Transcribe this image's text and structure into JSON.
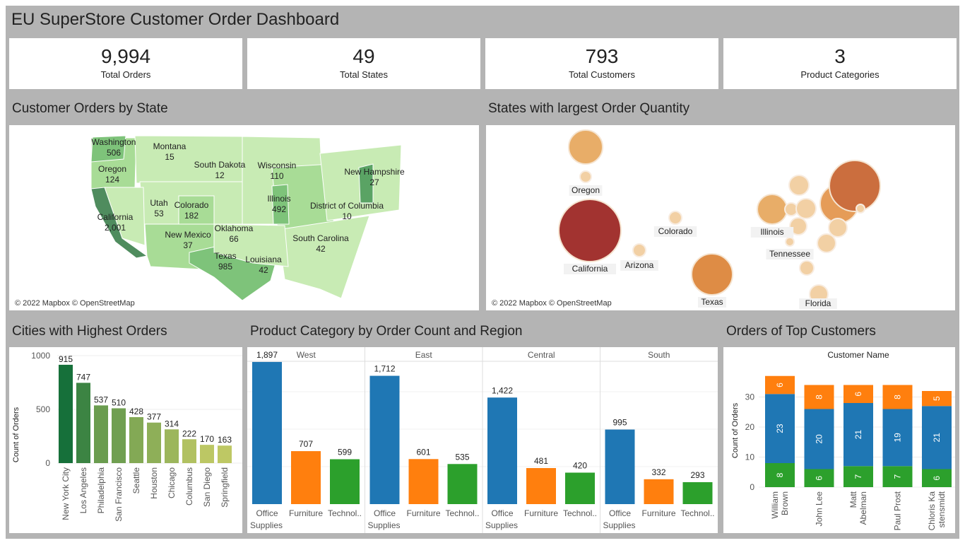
{
  "header": {
    "title": "EU SuperStore Customer Order Dashboard"
  },
  "kpis": [
    {
      "value": "9,994",
      "label": "Total Orders"
    },
    {
      "value": "49",
      "label": "Total States"
    },
    {
      "value": "793",
      "label": "Total Customers"
    },
    {
      "value": "3",
      "label": "Product Categories"
    }
  ],
  "sections": {
    "map": "Customer Orders by State",
    "bubbles": "States with largest Order Quantity",
    "cities": "Cities with Highest Orders",
    "category": "Product Category by Order Count and Region",
    "customers": "Orders of Top Customers"
  },
  "attribution": "© 2022 Mapbox © OpenStreetMap",
  "state_labels": [
    {
      "name": "Washington",
      "value": "506"
    },
    {
      "name": "Montana",
      "value": "15"
    },
    {
      "name": "Oregon",
      "value": "124"
    },
    {
      "name": "South Dakota",
      "value": "12"
    },
    {
      "name": "Wisconsin",
      "value": "110"
    },
    {
      "name": "New Hampshire",
      "value": "27"
    },
    {
      "name": "Illinois",
      "value": "492"
    },
    {
      "name": "Utah",
      "value": "53"
    },
    {
      "name": "Colorado",
      "value": "182"
    },
    {
      "name": "District of Columbia",
      "value": "10"
    },
    {
      "name": "California",
      "value": "2,001"
    },
    {
      "name": "New Mexico",
      "value": "37"
    },
    {
      "name": "Oklahoma",
      "value": "66"
    },
    {
      "name": "South Carolina",
      "value": "42"
    },
    {
      "name": "Texas",
      "value": "985"
    },
    {
      "name": "Louisiana",
      "value": "42"
    }
  ],
  "bubble_labels": [
    "Oregon",
    "Colorado",
    "California",
    "Arizona",
    "Illinois",
    "Tennessee",
    "Texas",
    "Florida"
  ],
  "chart_data": [
    {
      "type": "bar",
      "title": "Cities with Highest Orders",
      "ylabel": "Count of Orders",
      "categories": [
        "New York City",
        "Los Angeles",
        "Philadelphia",
        "San Francisco",
        "Seattle",
        "Houston",
        "Chicago",
        "Columbus",
        "San Diego",
        "Springfield"
      ],
      "values": [
        915,
        747,
        537,
        510,
        428,
        377,
        314,
        222,
        170,
        163
      ],
      "yticks": [
        0,
        500,
        1000
      ],
      "ylim": [
        0,
        1000
      ]
    },
    {
      "type": "bar",
      "title": "Product Category by Order Count and Region",
      "panels": [
        "West",
        "East",
        "Central",
        "South"
      ],
      "categories": [
        "Office Supplies",
        "Furniture",
        "Technology"
      ],
      "category_labels": [
        [
          "Office",
          "Supplies"
        ],
        [
          "Furniture"
        ],
        [
          "Technol.."
        ]
      ],
      "series_colors": [
        "#1f77b4",
        "#ff7f0e",
        "#2ca02c"
      ],
      "values": [
        [
          1897,
          707,
          599
        ],
        [
          1712,
          601,
          535
        ],
        [
          1422,
          481,
          420
        ],
        [
          995,
          332,
          293
        ]
      ],
      "value_labels": [
        [
          "1,897",
          "707",
          "599"
        ],
        [
          "1,712",
          "601",
          "535"
        ],
        [
          "1,422",
          "481",
          "420"
        ],
        [
          "995",
          "332",
          "293"
        ]
      ],
      "ylim": [
        0,
        2000
      ]
    },
    {
      "type": "bar",
      "title": "Orders of Top Customers",
      "xlabel": "Customer Name",
      "ylabel": "Count of Orders",
      "stacked": true,
      "categories": [
        "William Brown",
        "John Lee",
        "Matt Abelman",
        "Paul Prost",
        "Chloris Kastensmidt"
      ],
      "category_labels": [
        [
          "William",
          "Brown"
        ],
        [
          "John Lee"
        ],
        [
          "Matt",
          "Abelman"
        ],
        [
          "Paul Prost"
        ],
        [
          "Chloris Ka",
          "stensmidt"
        ]
      ],
      "series": [
        {
          "color": "#2ca02c",
          "values": [
            8,
            6,
            7,
            7,
            6
          ]
        },
        {
          "color": "#1f77b4",
          "values": [
            23,
            20,
            21,
            19,
            21
          ]
        },
        {
          "color": "#ff7f0e",
          "values": [
            6,
            8,
            6,
            8,
            5
          ]
        }
      ],
      "yticks": [
        0,
        10,
        20,
        30
      ],
      "ylim": [
        0,
        40
      ]
    }
  ]
}
